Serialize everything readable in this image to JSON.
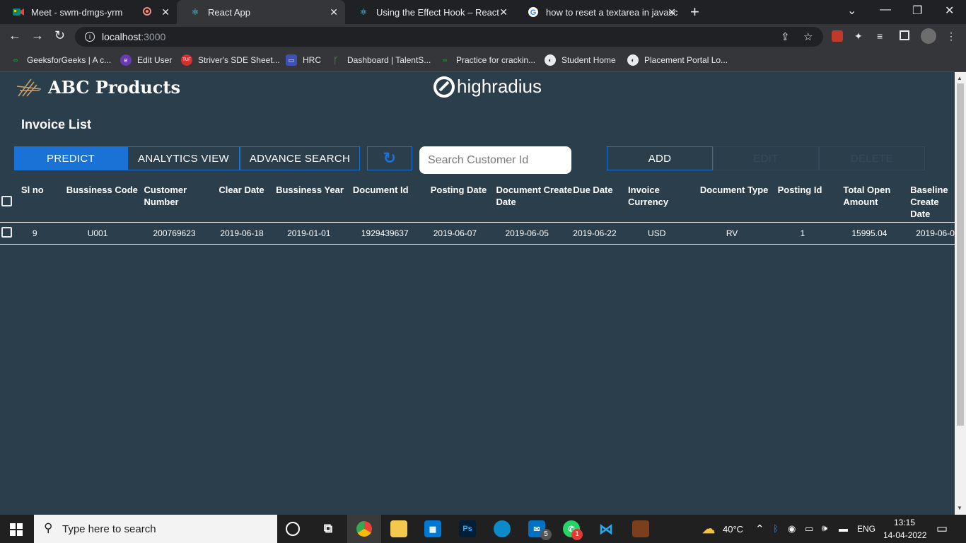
{
  "browser": {
    "tabs": [
      {
        "title": "Meet - swm-dmgs-yrm",
        "icon": "meet-icon",
        "color": "#00897b",
        "active": false
      },
      {
        "title": "React App",
        "icon": "react-icon",
        "color": "#61dafb",
        "active": true
      },
      {
        "title": "Using the Effect Hook – React",
        "icon": "react-icon",
        "color": "#61dafb",
        "active": false
      },
      {
        "title": "how to reset a textarea in javascri",
        "icon": "google-icon",
        "color": "#4285f4",
        "active": false
      }
    ],
    "url_host": "localhost",
    "url_port": ":3000",
    "bookmarks": [
      {
        "label": "GeeksforGeeks | A c...",
        "icon": "gfg-icon",
        "color": "#2f8d46"
      },
      {
        "label": "Edit User",
        "icon": "edit-user-icon",
        "color": "#6a3ab2"
      },
      {
        "label": "Striver's SDE Sheet...",
        "icon": "tuf-icon",
        "color": "#d32f2f"
      },
      {
        "label": "HRC",
        "icon": "hrc-icon",
        "color": "#3f51b5"
      },
      {
        "label": "Dashboard | TalentS...",
        "icon": "talent-icon",
        "color": "#6aa84f"
      },
      {
        "label": "Practice for crackin...",
        "icon": "gfg-icon",
        "color": "#2f8d46"
      },
      {
        "label": "Student Home",
        "icon": "globe-icon",
        "color": "#e8eaed"
      },
      {
        "label": "Placement Portal Lo...",
        "icon": "globe-icon",
        "color": "#e8eaed"
      }
    ]
  },
  "app": {
    "brand": "ABC Products",
    "partner_logo": "highradius",
    "title": "Invoice List",
    "buttons": {
      "predict": "PREDICT",
      "analytics": "ANALYTICS VIEW",
      "advance_search": "ADVANCE SEARCH",
      "add": "ADD",
      "edit": "EDIT",
      "delete": "DELETE"
    },
    "search_placeholder": "Search Customer Id",
    "accent": "#1a72d6",
    "background": "#2b3e4c"
  },
  "table": {
    "headers": [
      "Sl no",
      "Bussiness Code",
      "Customer Number",
      "Clear Date",
      "Bussiness Year",
      "Document Id",
      "Posting Date",
      "Document Create Date",
      "Due Date",
      "Invoice Currency",
      "Document Type",
      "Posting Id",
      "Total Open Amount",
      "Baseline Create Date"
    ],
    "rows": [
      [
        "9",
        "U001",
        "200769623",
        "2019-06-18",
        "2019-01-01",
        "1929439637",
        "2019-06-07",
        "2019-06-05",
        "2019-06-22",
        "USD",
        "RV",
        "1",
        "15995.04",
        "2019-06-0"
      ]
    ]
  },
  "taskbar": {
    "search_placeholder": "Type here to search",
    "weather": "40°C",
    "language": "ENG",
    "time": "13:15",
    "date": "14-04-2022",
    "mail_badge": "5",
    "whatsapp_badge": "1"
  }
}
